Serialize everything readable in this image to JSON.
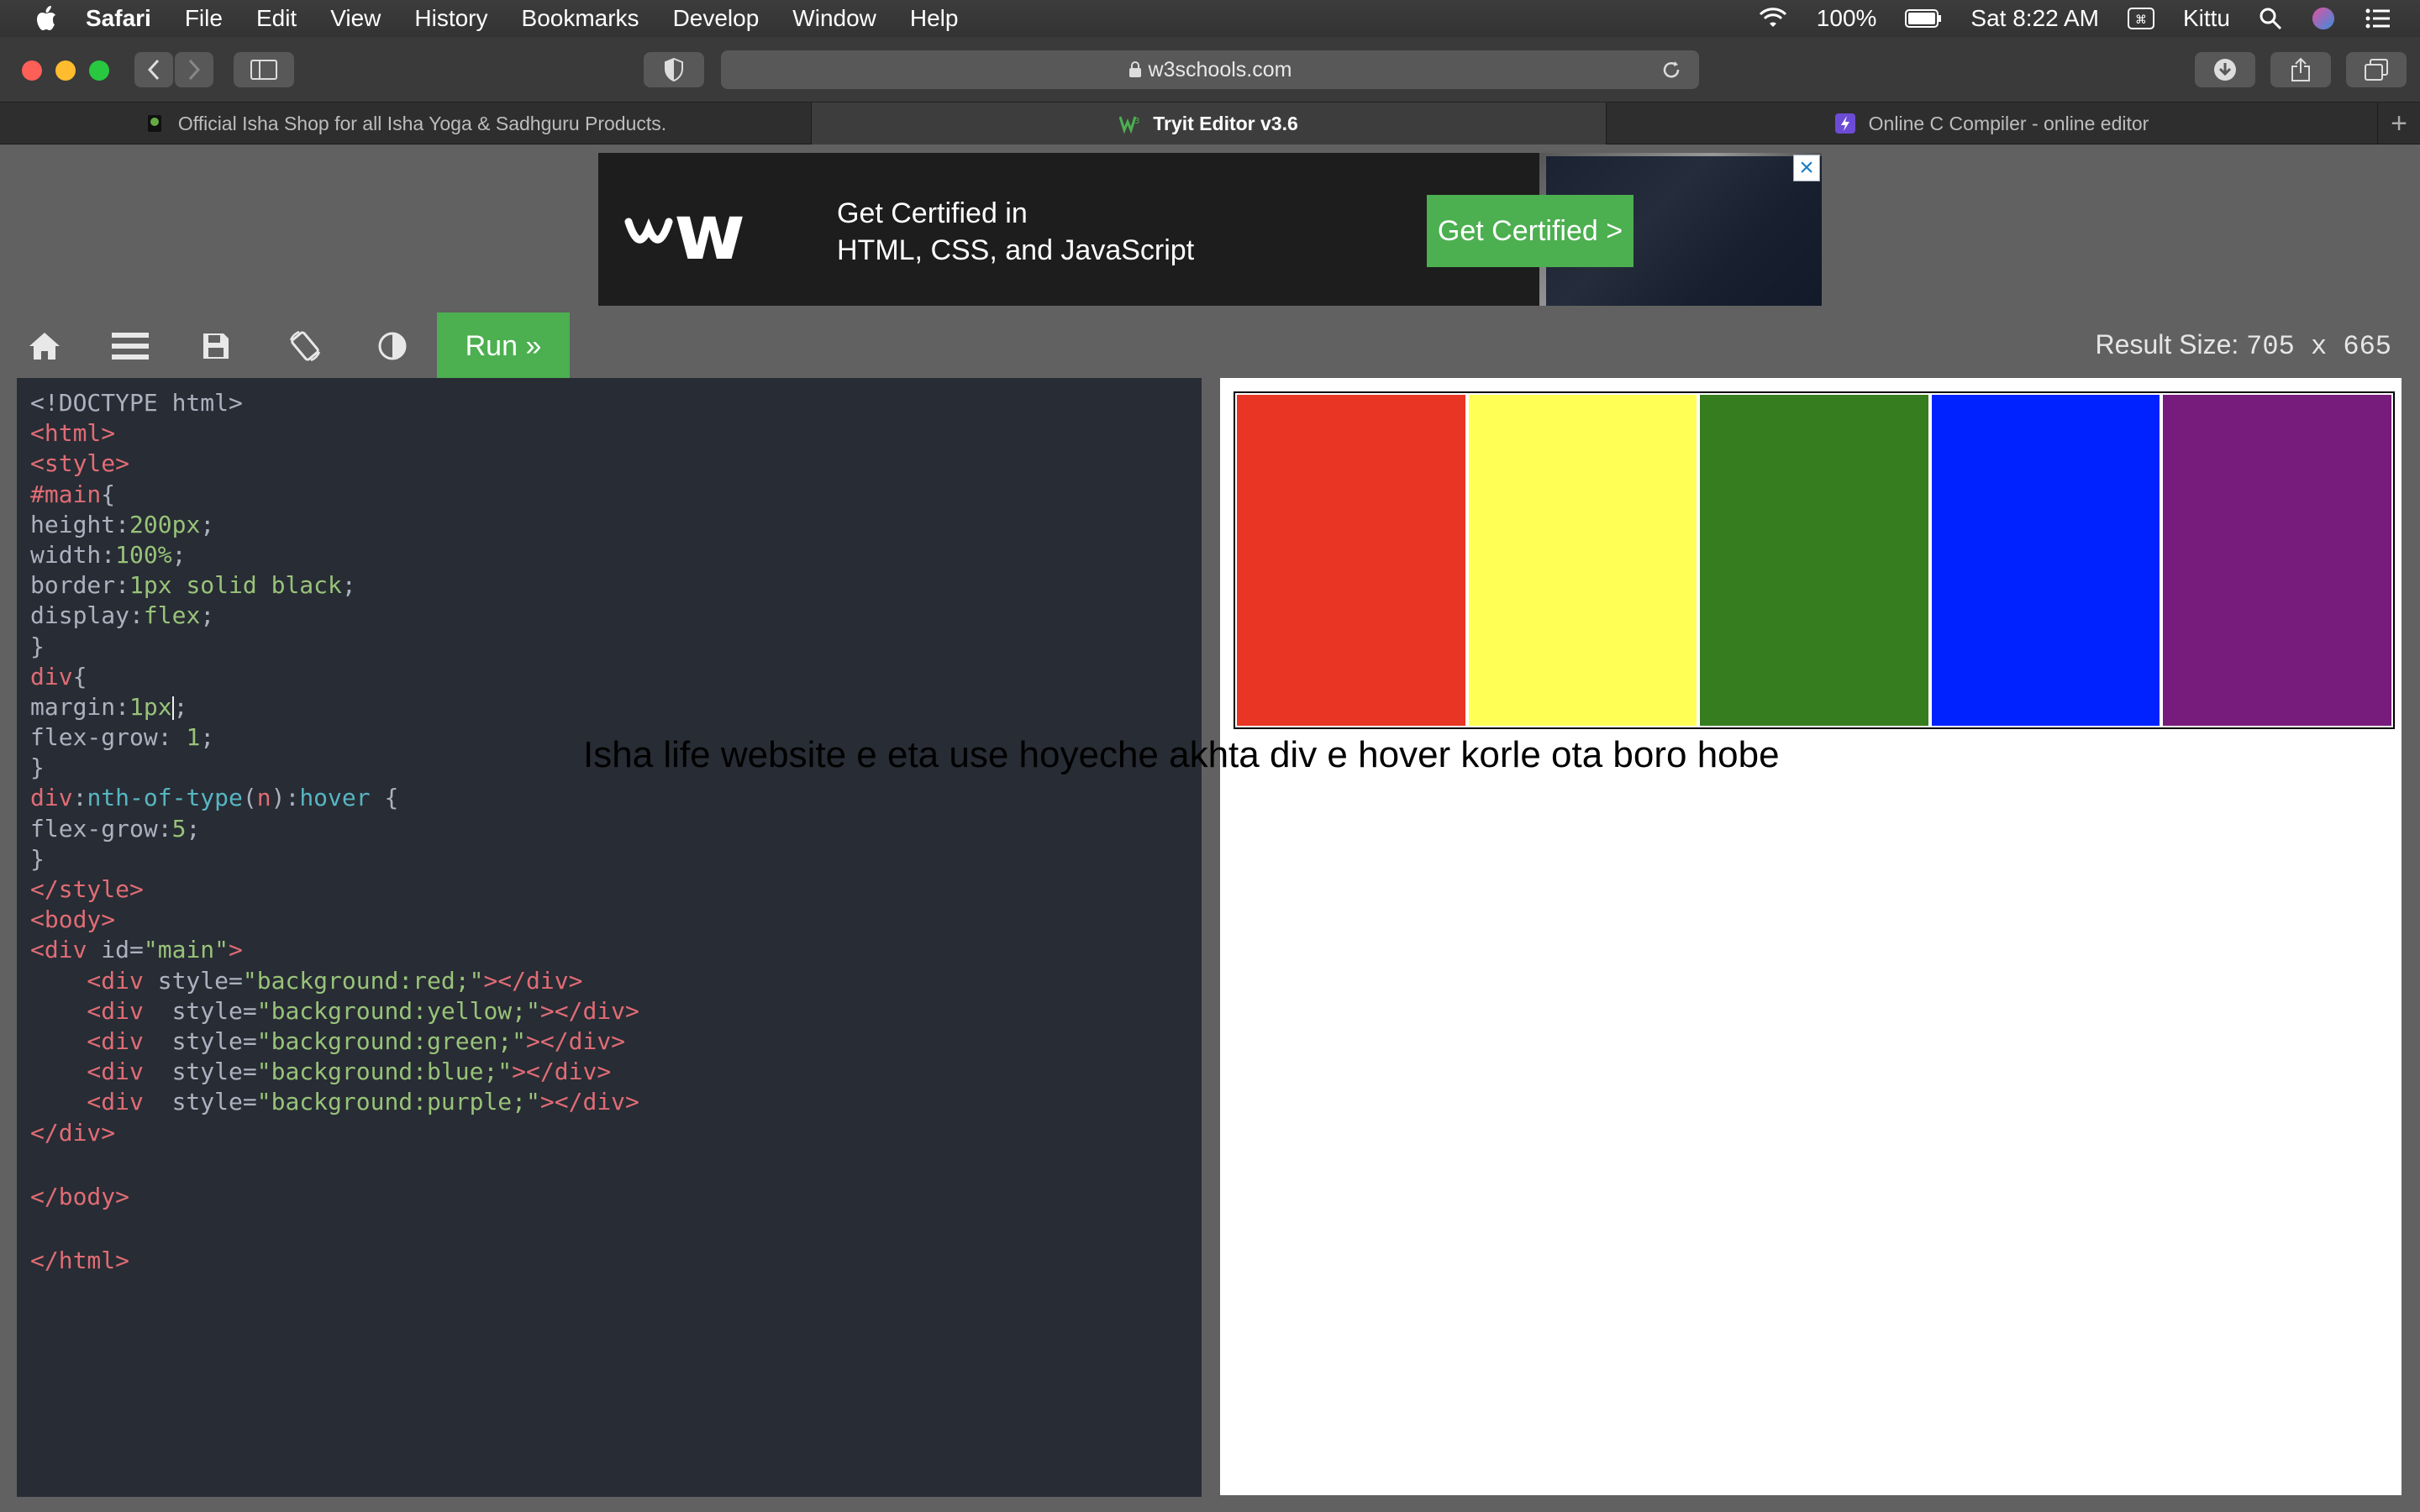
{
  "menubar": {
    "app": "Safari",
    "items": [
      "File",
      "Edit",
      "View",
      "History",
      "Bookmarks",
      "Develop",
      "Window",
      "Help"
    ],
    "battery": "100%",
    "clock": "Sat 8:22 AM",
    "user": "Kittu"
  },
  "toolbar": {
    "url": "w3schools.com"
  },
  "tabs": [
    {
      "label": "Official Isha Shop for all Isha Yoga & Sadhguru Products.",
      "active": false
    },
    {
      "label": "Tryit Editor v3.6",
      "active": true
    },
    {
      "label": "Online C Compiler - online editor",
      "active": false
    }
  ],
  "ad": {
    "logo": "w3",
    "line1": "Get Certified in",
    "line2": "HTML, CSS, and JavaScript",
    "button": "Get Certified >"
  },
  "editor": {
    "run_label": "Run »",
    "result_size_label": "Result Size:",
    "result_size_value": "705 x 665"
  },
  "code": [
    [
      [
        "<!DOCTYPE html>",
        "gray"
      ]
    ],
    [
      [
        "<html>",
        "red"
      ]
    ],
    [
      [
        "<style>",
        "red"
      ]
    ],
    [
      [
        "#main",
        "red"
      ],
      [
        "{",
        "gray"
      ]
    ],
    [
      [
        "height",
        "gray"
      ],
      [
        ":",
        "gray"
      ],
      [
        "200px",
        "green"
      ],
      [
        ";",
        "gray"
      ]
    ],
    [
      [
        "width",
        "gray"
      ],
      [
        ":",
        "gray"
      ],
      [
        "100%",
        "green"
      ],
      [
        ";",
        "gray"
      ]
    ],
    [
      [
        "border",
        "gray"
      ],
      [
        ":",
        "gray"
      ],
      [
        "1px solid black",
        "green"
      ],
      [
        ";",
        "gray"
      ]
    ],
    [
      [
        "display",
        "gray"
      ],
      [
        ":",
        "gray"
      ],
      [
        "flex",
        "green"
      ],
      [
        ";",
        "gray"
      ]
    ],
    [
      [
        "}",
        "gray"
      ]
    ],
    [
      [
        "div",
        "red"
      ],
      [
        "{",
        "gray"
      ]
    ],
    [
      [
        "margin",
        "gray"
      ],
      [
        ":",
        "gray"
      ],
      [
        "1px",
        "green"
      ],
      [
        "|caret|",
        "caret"
      ],
      [
        ";",
        "gray"
      ]
    ],
    [
      [
        "flex-grow",
        "gray"
      ],
      [
        ": ",
        "gray"
      ],
      [
        "1",
        "green"
      ],
      [
        ";",
        "gray"
      ]
    ],
    [
      [
        "}",
        "gray"
      ]
    ],
    [
      [
        "div",
        "red"
      ],
      [
        ":",
        "gray"
      ],
      [
        "nth-of-type",
        "teal"
      ],
      [
        "(",
        "gray"
      ],
      [
        "n",
        "red"
      ],
      [
        "):",
        "gray"
      ],
      [
        "hover",
        "teal"
      ],
      [
        " {",
        "gray"
      ]
    ],
    [
      [
        "flex-grow",
        "gray"
      ],
      [
        ":",
        "gray"
      ],
      [
        "5",
        "green"
      ],
      [
        ";",
        "gray"
      ]
    ],
    [
      [
        "}",
        "gray"
      ]
    ],
    [
      [
        "</style>",
        "red"
      ]
    ],
    [
      [
        "<body>",
        "red"
      ]
    ],
    [
      [
        "<div ",
        "red"
      ],
      [
        "id=",
        "gray"
      ],
      [
        "\"main\"",
        "green"
      ],
      [
        ">",
        "red"
      ]
    ],
    [
      [
        "    <div ",
        "red"
      ],
      [
        "style=",
        "gray"
      ],
      [
        "\"background:red;\"",
        "green"
      ],
      [
        "></div>",
        "red"
      ]
    ],
    [
      [
        "    <div  ",
        "red"
      ],
      [
        "style=",
        "gray"
      ],
      [
        "\"background:yellow;\"",
        "green"
      ],
      [
        "></div>",
        "red"
      ]
    ],
    [
      [
        "    <div  ",
        "red"
      ],
      [
        "style=",
        "gray"
      ],
      [
        "\"background:green;\"",
        "green"
      ],
      [
        "></div>",
        "red"
      ]
    ],
    [
      [
        "    <div  ",
        "red"
      ],
      [
        "style=",
        "gray"
      ],
      [
        "\"background:blue;\"",
        "green"
      ],
      [
        "></div>",
        "red"
      ]
    ],
    [
      [
        "    <div  ",
        "red"
      ],
      [
        "style=",
        "gray"
      ],
      [
        "\"background:purple;\"",
        "green"
      ],
      [
        "></div>",
        "red"
      ]
    ],
    [
      [
        "</div>",
        "red"
      ]
    ],
    [
      [
        "",
        "gray"
      ]
    ],
    [
      [
        "</body>",
        "red"
      ]
    ],
    [
      [
        "",
        "gray"
      ]
    ],
    [
      [
        "</html>",
        "red"
      ]
    ]
  ],
  "result": {
    "cells": [
      {
        "name": "red",
        "color": "#e83524"
      },
      {
        "name": "yellow",
        "color": "#ffff55"
      },
      {
        "name": "green",
        "color": "#367d1f"
      },
      {
        "name": "blue",
        "color": "#0022ff"
      },
      {
        "name": "purple",
        "color": "#771b7c"
      }
    ]
  },
  "overlay_text": "Isha life website e eta use hoyeche akhta div e hover korle ota boro hobe"
}
